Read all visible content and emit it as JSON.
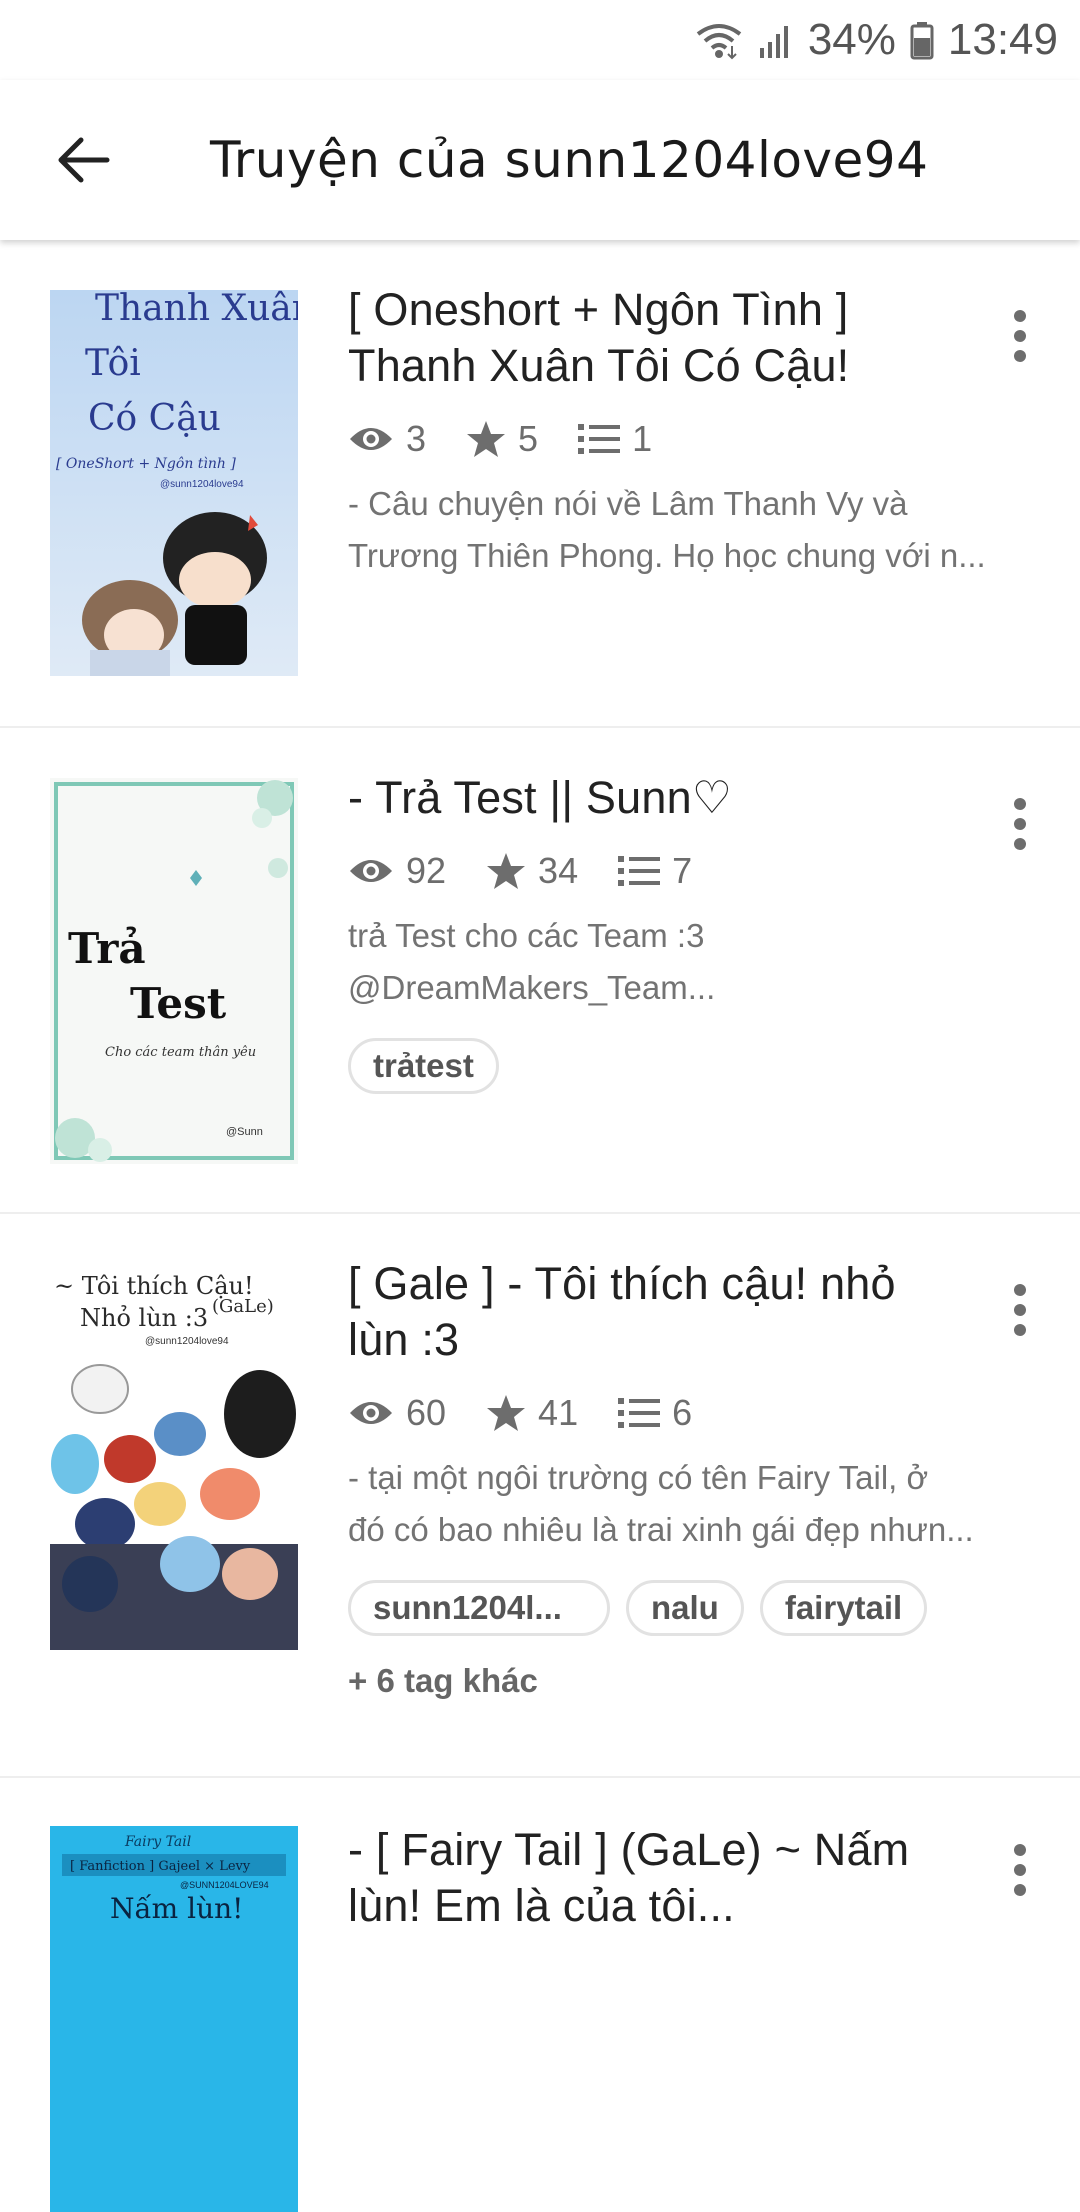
{
  "status_bar": {
    "battery": "34%",
    "time": "13:49"
  },
  "header": {
    "title": "Truyện của sunn1204love94"
  },
  "stories": [
    {
      "title_lines": [
        "[ Oneshort + Ngôn Tình ]",
        "Thanh Xuân Tôi Có Cậu!"
      ],
      "views": "3",
      "votes": "5",
      "parts": "1",
      "description_lines": [
        "- Câu chuyện nói về Lâm Thanh Vy và",
        "Trương Thiên Phong. Họ học chung với n..."
      ],
      "cover": {
        "lines": [
          "Thanh Xuân",
          "Tôi",
          "Có Cậu",
          "[ OneShort + Ngôn tình ]",
          "@sunn1204love94"
        ]
      }
    },
    {
      "title_lines": [
        "- Trả Test || Sunn♡"
      ],
      "views": "92",
      "votes": "34",
      "parts": "7",
      "description_lines": [
        "trả Test cho các Team :3",
        "@DreamMakers_Team..."
      ],
      "tags": [
        "trảtest"
      ],
      "cover": {
        "lines": [
          "Trả",
          "Test",
          "Cho các team thân yêu",
          "@Sunn"
        ]
      }
    },
    {
      "title_lines": [
        "[ Gale ] - Tôi thích cậu! nhỏ",
        "lùn :3"
      ],
      "views": "60",
      "votes": "41",
      "parts": "6",
      "description_lines": [
        "- tại một ngôi trường có tên Fairy Tail, ở",
        "đó có bao nhiêu là trai xinh gái đẹp nhưn..."
      ],
      "tags": [
        "sunn1204l...",
        "nalu",
        "fairytail"
      ],
      "more_tags": "+ 6 tag khác",
      "cover": {
        "lines": [
          "~ Tôi thích Cậu!",
          "Nhỏ lùn :3",
          "(GaLe)",
          "@sunn1204love94"
        ]
      }
    },
    {
      "title_lines": [
        "- [ Fairy Tail ] (GaLe) ~ Nấm",
        "lùn! Em là của tôi..."
      ],
      "cover": {
        "lines": [
          "Fairy Tail",
          "[ Fanfiction ] Gajeel × Levy",
          "@SUNN1204LOVE94",
          "Nấm lùn!"
        ]
      }
    }
  ],
  "colors": {
    "text_primary": "#222222",
    "text_secondary": "#737373",
    "divider": "#eeeeee",
    "tag_border": "#e2e2e2"
  },
  "icons": {
    "back": "arrow-left",
    "views": "eye",
    "votes": "star",
    "parts": "list",
    "menu": "vertical-dots"
  }
}
